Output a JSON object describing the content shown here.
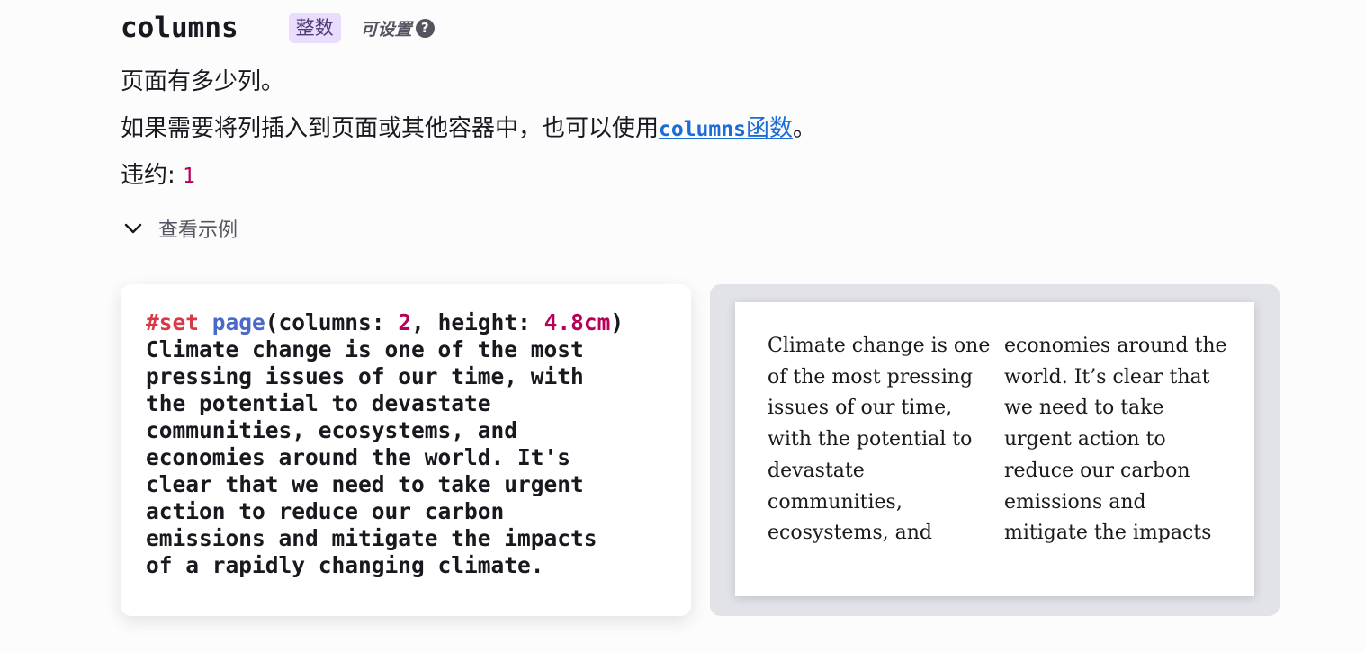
{
  "param": {
    "name": "columns",
    "type_label": "整数",
    "settable_label": "可设置",
    "help_icon_glyph": "?"
  },
  "description": {
    "line1": "页面有多少列。",
    "line2_prefix": "如果需要将列插入到页面或其他容器中，也可以使用",
    "link_code": "columns",
    "link_text": "函数",
    "line2_suffix": "。",
    "default_label": "违约:",
    "default_value": "1"
  },
  "examples": {
    "toggle_label": "查看示例",
    "toggle_icon": "chevron-down-icon"
  },
  "code": {
    "kw": "#set",
    "fn": "page",
    "open": "(columns: ",
    "num1": "2",
    "mid": ", height: ",
    "num2": "4.8cm",
    "close": ")",
    "lines": [
      "Climate change is one of the most",
      "pressing issues of our time, with",
      "the potential to devastate",
      "communities, ecosystems, and",
      "economies around the world. It's",
      "clear that we need to take urgent",
      "action to reduce our carbon",
      "emissions and mitigate the impacts",
      "of a rapidly changing climate."
    ]
  },
  "preview": {
    "left_column": [
      "Climate change is one",
      "of the most pressing",
      "issues of our time,",
      "with the potential to",
      "devastate",
      "communities,",
      "ecosystems, and"
    ],
    "right_column": [
      "economies around the",
      "world. It’s clear that",
      "we need to take",
      "urgent action to",
      "reduce our carbon",
      "emissions and",
      "mitigate the impacts"
    ]
  },
  "colors": {
    "keyword": "#d73948",
    "function": "#4b69c6",
    "number": "#b60158",
    "link": "#1b6dd6",
    "type_pill_bg": "#e9dcfd"
  }
}
